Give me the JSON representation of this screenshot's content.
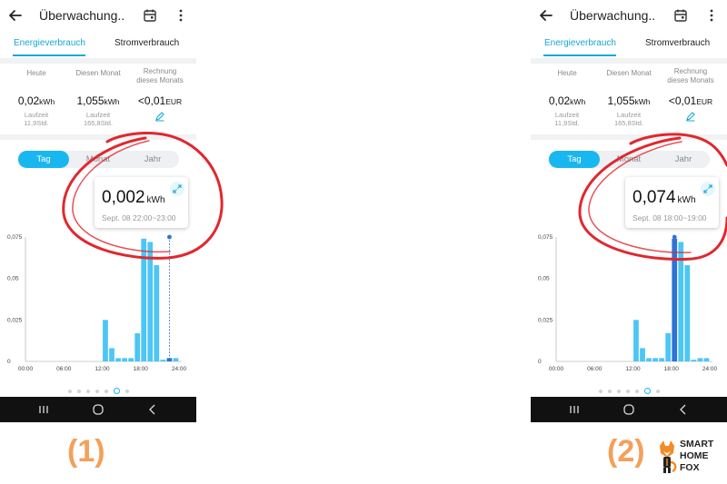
{
  "screens": [
    {
      "title": "Überwachung...",
      "tabs": [
        "Energieverbrauch",
        "Stromverbrauch"
      ],
      "stats": {
        "today_label": "Heute",
        "today_value": "0,02",
        "today_unit": "kWh",
        "today_runtime_label": "Laufzeit",
        "today_runtime": "11,9Std.",
        "month_label": "Diesen Monat",
        "month_value": "1,055",
        "month_unit": "kWh",
        "month_runtime_label": "Laufzeit",
        "month_runtime": "165,8Std.",
        "bill_label_1": "Rechnung",
        "bill_label_2": "dieses Monats",
        "bill_value": "<0,01",
        "bill_unit": "EUR"
      },
      "segments": [
        "Tag",
        "Monat",
        "Jahr"
      ],
      "tooltip": {
        "value": "0,002",
        "unit": "kWh",
        "time": "Sept. 08 22:00~23:00"
      },
      "caption": "(1)",
      "chart_data": {
        "type": "bar",
        "categories": [
          "00",
          "01",
          "02",
          "03",
          "04",
          "05",
          "06",
          "07",
          "08",
          "09",
          "10",
          "11",
          "12",
          "13",
          "14",
          "15",
          "16",
          "17",
          "18",
          "19",
          "20",
          "21",
          "22",
          "23"
        ],
        "values": [
          0,
          0,
          0,
          0,
          0,
          0,
          0,
          0,
          0,
          0,
          0,
          0,
          0.025,
          0.008,
          0.002,
          0.002,
          0.002,
          0.017,
          0.074,
          0.072,
          0.058,
          0.001,
          0.002,
          0.002
        ],
        "x_tick_labels": [
          "00:00",
          "06:00",
          "12:00",
          "18:00",
          "24:00"
        ],
        "y_tick_labels": [
          "0",
          "0,025",
          "0,05",
          "0,075"
        ],
        "ylim": [
          0,
          0.075
        ],
        "selected_index": 22
      }
    },
    {
      "title": "Überwachung...",
      "tabs": [
        "Energieverbrauch",
        "Stromverbrauch"
      ],
      "stats": {
        "today_label": "Heute",
        "today_value": "0,02",
        "today_unit": "kWh",
        "today_runtime_label": "Laufzeit",
        "today_runtime": "11,9Std.",
        "month_label": "Diesen Monat",
        "month_value": "1,055",
        "month_unit": "kWh",
        "month_runtime_label": "Laufzeit",
        "month_runtime": "165,8Std.",
        "bill_label_1": "Rechnung",
        "bill_label_2": "dieses Monats",
        "bill_value": "<0,01",
        "bill_unit": "EUR"
      },
      "segments": [
        "Tag",
        "Monat",
        "Jahr"
      ],
      "tooltip": {
        "value": "0,074",
        "unit": "kWh",
        "time": "Sept. 08 18:00~19:00"
      },
      "caption": "(2)",
      "chart_data": {
        "type": "bar",
        "categories": [
          "00",
          "01",
          "02",
          "03",
          "04",
          "05",
          "06",
          "07",
          "08",
          "09",
          "10",
          "11",
          "12",
          "13",
          "14",
          "15",
          "16",
          "17",
          "18",
          "19",
          "20",
          "21",
          "22",
          "23"
        ],
        "values": [
          0,
          0,
          0,
          0,
          0,
          0,
          0,
          0,
          0,
          0,
          0,
          0,
          0.025,
          0.008,
          0.002,
          0.002,
          0.002,
          0.017,
          0.074,
          0.072,
          0.058,
          0.001,
          0.002,
          0.002
        ],
        "x_tick_labels": [
          "00:00",
          "06:00",
          "12:00",
          "18:00",
          "24:00"
        ],
        "y_tick_labels": [
          "0",
          "0,025",
          "0,05",
          "0,075"
        ],
        "ylim": [
          0,
          0.075
        ],
        "selected_index": 18
      }
    }
  ],
  "brand": {
    "line1": "SMART",
    "line2": "HOME",
    "line3": "FOX"
  },
  "colors": {
    "accent": "#17a8d6",
    "bar_light": "#4cc6f5",
    "bar_selected": "#2f73d8",
    "highlight_ring": "#e0282e",
    "caption": "#f4a05a"
  }
}
